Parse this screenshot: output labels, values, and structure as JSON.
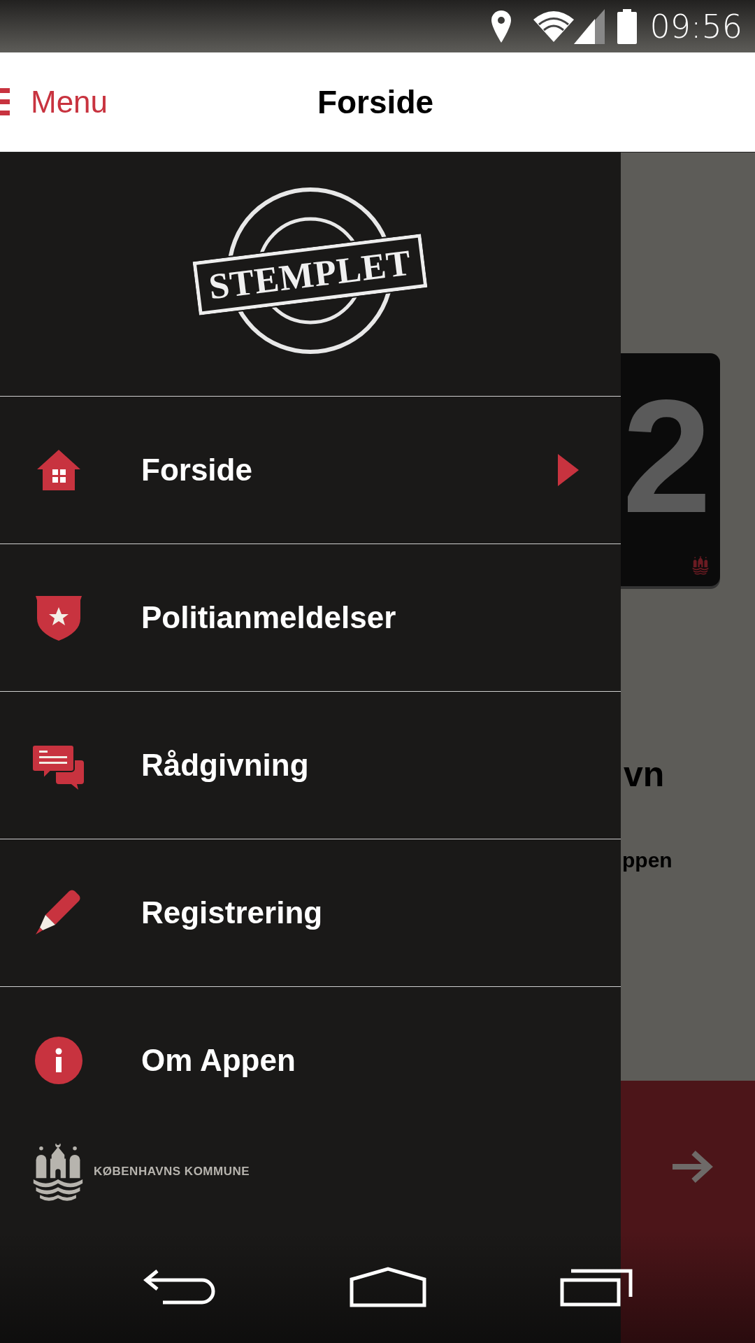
{
  "status_bar": {
    "time": "09:56"
  },
  "app_bar": {
    "menu_label": "Menu",
    "title": "Forside"
  },
  "background": {
    "card_digit": "2",
    "heading": "vn",
    "text": "ppen"
  },
  "drawer": {
    "logo_text": "STEMPLET",
    "items": [
      {
        "label": "Forside",
        "kind": "home",
        "selected": true
      },
      {
        "label": "Politianmeldelser",
        "kind": "shield",
        "selected": false
      },
      {
        "label": "Rådgivning",
        "kind": "chat",
        "selected": false
      },
      {
        "label": "Registrering",
        "kind": "pencil",
        "selected": false
      },
      {
        "label": "Om Appen",
        "kind": "info",
        "selected": false
      }
    ],
    "footer_text": "KØBENHAVNS KOMMUNE"
  }
}
